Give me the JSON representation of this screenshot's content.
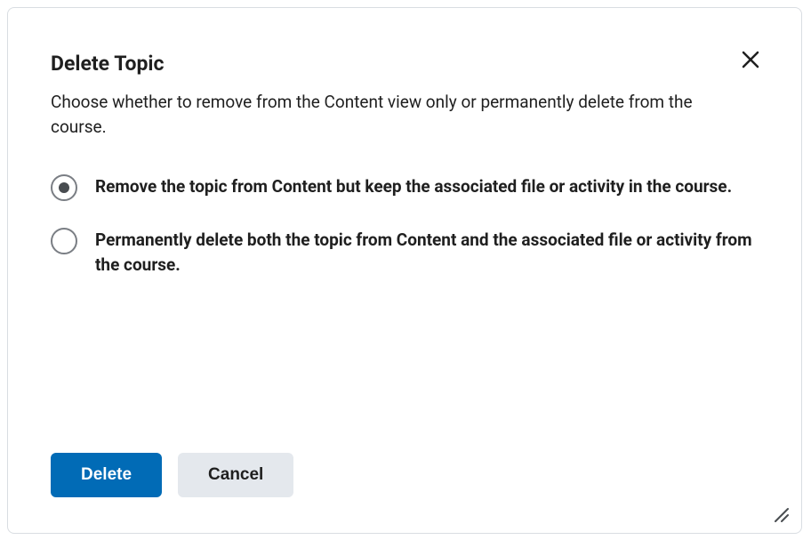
{
  "dialog": {
    "title": "Delete Topic",
    "subtitle": "Choose whether to remove from the Content view only or permanently delete from the course.",
    "options": [
      {
        "label": "Remove the topic from Content but keep the associated file or activity in the course.",
        "selected": true
      },
      {
        "label": "Permanently delete both the topic from Content and the associated file or activity from the course.",
        "selected": false
      }
    ],
    "buttons": {
      "primary": "Delete",
      "secondary": "Cancel"
    }
  }
}
